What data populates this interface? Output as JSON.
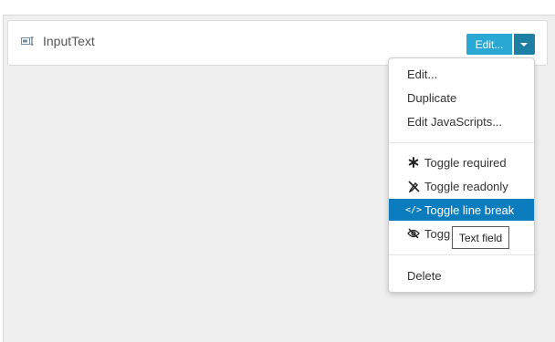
{
  "field": {
    "name": "InputText",
    "icon": "input-text-icon"
  },
  "buttons": {
    "edit_label": "Edit...",
    "accent": "#2aa8d4",
    "dropdown_accent": "#1e7fa5"
  },
  "menu": {
    "group1": [
      {
        "label": "Edit..."
      },
      {
        "label": "Duplicate"
      },
      {
        "label": "Edit JavaScripts..."
      }
    ],
    "group2": [
      {
        "label": "Toggle required",
        "icon": "asterisk-icon"
      },
      {
        "label": "Toggle readonly",
        "icon": "pencil-slash-icon"
      },
      {
        "label": "Toggle line break",
        "icon": "code-icon",
        "active": true
      },
      {
        "label": "Toggle hidden",
        "visible_text": "Togg",
        "icon": "eye-slash-icon"
      }
    ],
    "group3": [
      {
        "label": "Delete"
      }
    ],
    "active_color": "#0b7dbf"
  },
  "tooltip": {
    "text": "Text field"
  }
}
